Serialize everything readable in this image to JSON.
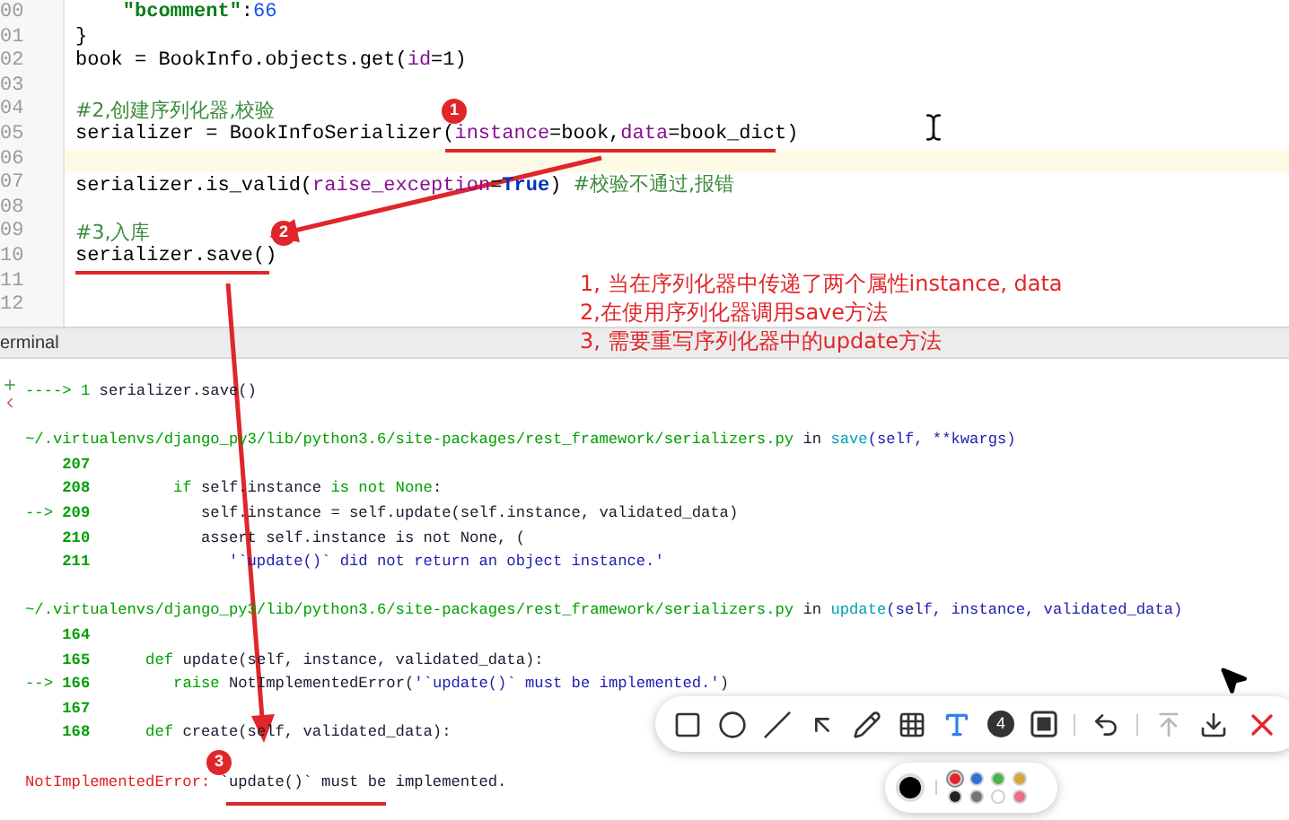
{
  "editor": {
    "lines": [
      {
        "number": "00",
        "current": false,
        "tokens": [
          {
            "text": "    \"bcomment\"",
            "kind": "string"
          },
          {
            "text": ":",
            "kind": "plain"
          },
          {
            "text": "66",
            "kind": "number"
          }
        ]
      },
      {
        "number": "01",
        "current": false,
        "tokens": [
          {
            "text": "}",
            "kind": "plain"
          }
        ]
      },
      {
        "number": "02",
        "current": false,
        "tokens": [
          {
            "text": "book = BookInfo.objects.get(",
            "kind": "plain"
          },
          {
            "text": "id",
            "kind": "param"
          },
          {
            "text": "=1)",
            "kind": "plain"
          }
        ]
      },
      {
        "number": "03",
        "current": false
      },
      {
        "number": "04",
        "current": false,
        "tokens": [
          {
            "text": "#2,创建序列化器,校验",
            "kind": "comment"
          }
        ]
      },
      {
        "number": "05",
        "current": false,
        "tokens": [
          {
            "text": "serializer = BookInfoSerializer(",
            "kind": "plain"
          },
          {
            "text": "instance",
            "kind": "param"
          },
          {
            "text": "=book,",
            "kind": "plain"
          },
          {
            "text": "data",
            "kind": "param"
          },
          {
            "text": "=book_dict)",
            "kind": "plain"
          }
        ]
      },
      {
        "number": "06",
        "current": true
      },
      {
        "number": "07",
        "current": false,
        "tokens": [
          {
            "text": "serializer.is_valid(",
            "kind": "plain"
          },
          {
            "text": "raise_exception",
            "kind": "param"
          },
          {
            "text": "=",
            "kind": "plain"
          },
          {
            "text": "True",
            "kind": "keyword"
          },
          {
            "text": ") ",
            "kind": "plain"
          },
          {
            "text": "#校验不通过,报错",
            "kind": "comment"
          }
        ]
      },
      {
        "number": "08",
        "current": false
      },
      {
        "number": "09",
        "current": false,
        "tokens": [
          {
            "text": "#3,入库",
            "kind": "comment"
          }
        ]
      },
      {
        "number": "10",
        "current": false,
        "tokens": [
          {
            "text": "serializer.save()",
            "kind": "plain"
          }
        ]
      },
      {
        "number": "11",
        "current": false
      },
      {
        "number": "12",
        "current": false
      }
    ]
  },
  "notes": [
    "1, 当在序列化器中传递了两个属性instance, data",
    "2,在使用序列化器调用save方法",
    "3, 需要重写序列化器中的update方法"
  ],
  "markers": [
    "1",
    "2",
    "3"
  ],
  "terminal": {
    "title": "erminal",
    "sections": [
      [
        {
          "tokens": [
            {
              "text": "---->",
              "kind": "arrow"
            },
            {
              "text": " 1 ",
              "kind": "green"
            },
            {
              "text": "serializer.save()",
              "kind": "plain"
            }
          ]
        }
      ],
      [
        {
          "tokens": [
            {
              "text": "~/.virtualenvs/django_py3/lib/python3.6/site-packages/rest_framework/serializers.py",
              "kind": "green"
            },
            {
              "text": " in ",
              "kind": "plain"
            },
            {
              "text": "save",
              "kind": "func"
            },
            {
              "text": "(self, **kwargs)",
              "kind": "args"
            }
          ]
        },
        {
          "tokens": [
            {
              "text": "    207",
              "kind": "lineno"
            }
          ]
        },
        {
          "tokens": [
            {
              "text": "    208",
              "kind": "lineno"
            },
            {
              "text": "         if",
              "kind": "green"
            },
            {
              "text": " self.instance ",
              "kind": "plain"
            },
            {
              "text": "is not None",
              "kind": "green"
            },
            {
              "text": ":",
              "kind": "plain"
            }
          ]
        },
        {
          "tokens": [
            {
              "text": "-->",
              "kind": "arrow"
            },
            {
              "text": " 209",
              "kind": "lineno"
            },
            {
              "text": "            self.instance = self.update(self.instance, validated_data)",
              "kind": "plain"
            }
          ]
        },
        {
          "tokens": [
            {
              "text": "    210",
              "kind": "lineno"
            },
            {
              "text": "            assert self.instance is not None, (",
              "kind": "plain"
            }
          ]
        },
        {
          "tokens": [
            {
              "text": "    211",
              "kind": "lineno"
            },
            {
              "text": "               '`update()` did not return an object instance.'",
              "kind": "args"
            }
          ]
        }
      ],
      [
        {
          "tokens": [
            {
              "text": "~/.virtualenvs/django_py3/lib/python3.6/site-packages/rest_framework/serializers.py",
              "kind": "green"
            },
            {
              "text": " in ",
              "kind": "plain"
            },
            {
              "text": "update",
              "kind": "func"
            },
            {
              "text": "(self, instance, validated_data)",
              "kind": "args"
            }
          ]
        },
        {
          "tokens": [
            {
              "text": "    164",
              "kind": "lineno"
            }
          ]
        },
        {
          "tokens": [
            {
              "text": "    165",
              "kind": "lineno"
            },
            {
              "text": "      def",
              "kind": "green"
            },
            {
              "text": " update(self, instance, validated_data):",
              "kind": "plain"
            }
          ]
        },
        {
          "tokens": [
            {
              "text": "-->",
              "kind": "arrow"
            },
            {
              "text": " 166",
              "kind": "lineno"
            },
            {
              "text": "         raise",
              "kind": "green"
            },
            {
              "text": " NotImplementedError(",
              "kind": "plain"
            },
            {
              "text": "'`update()` must be implemented.'",
              "kind": "args"
            },
            {
              "text": ")",
              "kind": "plain"
            }
          ]
        },
        {
          "tokens": [
            {
              "text": "    167",
              "kind": "lineno"
            }
          ]
        },
        {
          "tokens": [
            {
              "text": "    168",
              "kind": "lineno"
            },
            {
              "text": "      def",
              "kind": "green"
            },
            {
              "text": " create(self, validated_data):",
              "kind": "plain"
            }
          ]
        }
      ],
      [
        {
          "tokens": [
            {
              "text": "NotImplementedError:",
              "kind": "error"
            },
            {
              "text": " `update()` must be implemented.",
              "kind": "plain"
            }
          ]
        }
      ]
    ]
  },
  "toolbar": {
    "tools": [
      {
        "kind": "rectangle",
        "selected": false
      },
      {
        "kind": "circle",
        "selected": false
      },
      {
        "kind": "line",
        "selected": false
      },
      {
        "kind": "arrow",
        "selected": false
      },
      {
        "kind": "pen",
        "selected": false
      },
      {
        "kind": "mosaic",
        "selected": false
      },
      {
        "kind": "text",
        "selected": true
      },
      {
        "kind": "number",
        "label": "4",
        "selected": false
      },
      {
        "kind": "frame",
        "selected": false
      },
      {
        "kind": "separator"
      },
      {
        "kind": "undo",
        "selected": false
      },
      {
        "kind": "separator"
      },
      {
        "kind": "pin",
        "selected": false,
        "disabled": true
      },
      {
        "kind": "download",
        "selected": false
      },
      {
        "kind": "close",
        "selected": false
      }
    ],
    "colors": [
      {
        "color": "#e8242a",
        "selected": true
      },
      {
        "color": "#2f6fd6",
        "selected": false
      },
      {
        "color": "#4bb44b",
        "selected": false
      },
      {
        "color": "#d9a540",
        "selected": false
      },
      {
        "color": "#222222",
        "selected": false
      },
      {
        "color": "#6f757c",
        "selected": false
      },
      {
        "color": "#ffffff",
        "selected": false
      },
      {
        "color": "#ec6e8c",
        "selected": false
      }
    ]
  }
}
